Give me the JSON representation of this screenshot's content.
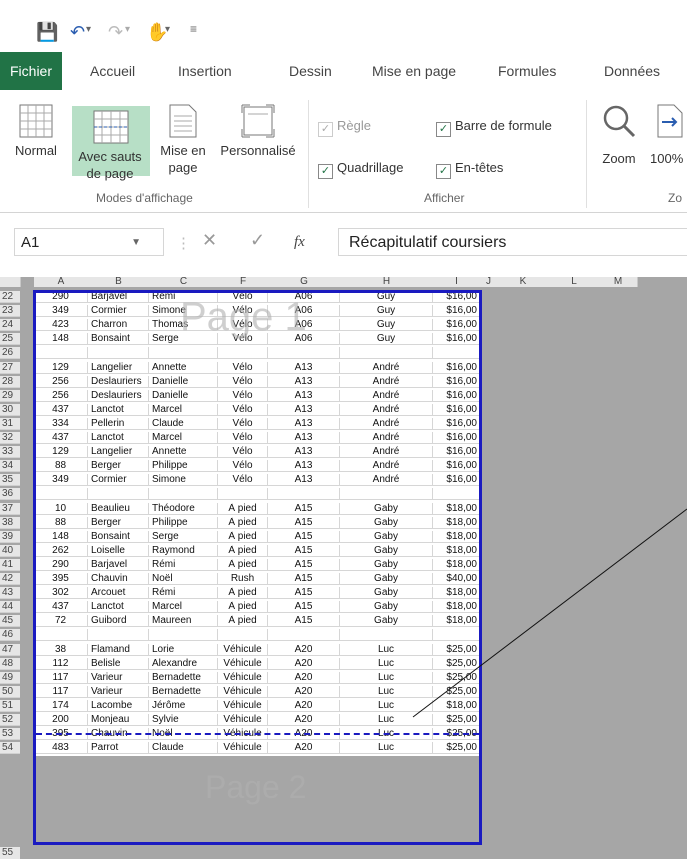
{
  "ribbon_tabs": [
    "Fichier",
    "Accueil",
    "Insertion",
    "Dessin",
    "Mise en page",
    "Formules",
    "Données"
  ],
  "view_group": {
    "buttons": [
      {
        "label": "Normal",
        "icon": "normal-view-icon"
      },
      {
        "label": "Avec sauts de page",
        "icon": "page-break-view-icon"
      },
      {
        "label": "Mise en page",
        "icon": "page-layout-view-icon"
      },
      {
        "label": "Personnalisé",
        "icon": "custom-view-icon"
      }
    ],
    "group_label": "Modes d'affichage"
  },
  "show_group": {
    "checks": [
      {
        "label": "Règle",
        "checked": true,
        "enabled": false
      },
      {
        "label": "Barre de formule",
        "checked": true,
        "enabled": true
      },
      {
        "label": "Quadrillage",
        "checked": true,
        "enabled": true
      },
      {
        "label": "En-têtes",
        "checked": true,
        "enabled": true
      }
    ],
    "group_label": "Afficher"
  },
  "zoom_group": {
    "zoom_label": "Zoom",
    "hundred_label": "100%",
    "group_label_partial": "Zo"
  },
  "formula_bar": {
    "name_box": "A1",
    "fx_label": "fx",
    "content": "Récapitulatif coursiers"
  },
  "columns": [
    "A",
    "B",
    "C",
    "F",
    "G",
    "H",
    "I",
    "J",
    "K",
    "L",
    "M"
  ],
  "rows": [
    {
      "n": "22",
      "cells": [
        "290",
        "Barjavel",
        "Rémi",
        "Vélo",
        "A06",
        "Guy",
        "$16,00"
      ]
    },
    {
      "n": "23",
      "cells": [
        "349",
        "Cormier",
        "Simone",
        "Vélo",
        "A06",
        "Guy",
        "$16,00"
      ]
    },
    {
      "n": "24",
      "cells": [
        "423",
        "Charron",
        "Thomas",
        "Vélo",
        "A06",
        "Guy",
        "$16,00"
      ]
    },
    {
      "n": "25",
      "cells": [
        "148",
        "Bonsaint",
        "Serge",
        "Vélo",
        "A06",
        "Guy",
        "$16,00"
      ]
    },
    {
      "n": "26",
      "cells": [
        "",
        "",
        "",
        "",
        "",
        "",
        ""
      ]
    },
    {
      "n": "27",
      "cells": [
        "129",
        "Langelier",
        "Annette",
        "Vélo",
        "A13",
        "André",
        "$16,00"
      ]
    },
    {
      "n": "28",
      "cells": [
        "256",
        "Deslauriers",
        "Danielle",
        "Vélo",
        "A13",
        "André",
        "$16,00"
      ]
    },
    {
      "n": "29",
      "cells": [
        "256",
        "Deslauriers",
        "Danielle",
        "Vélo",
        "A13",
        "André",
        "$16,00"
      ]
    },
    {
      "n": "30",
      "cells": [
        "437",
        "Lanctot",
        "Marcel",
        "Vélo",
        "A13",
        "André",
        "$16,00"
      ]
    },
    {
      "n": "31",
      "cells": [
        "334",
        "Pellerin",
        "Claude",
        "Vélo",
        "A13",
        "André",
        "$16,00"
      ]
    },
    {
      "n": "32",
      "cells": [
        "437",
        "Lanctot",
        "Marcel",
        "Vélo",
        "A13",
        "André",
        "$16,00"
      ]
    },
    {
      "n": "33",
      "cells": [
        "129",
        "Langelier",
        "Annette",
        "Vélo",
        "A13",
        "André",
        "$16,00"
      ]
    },
    {
      "n": "34",
      "cells": [
        "88",
        "Berger",
        "Philippe",
        "Vélo",
        "A13",
        "André",
        "$16,00"
      ]
    },
    {
      "n": "35",
      "cells": [
        "349",
        "Cormier",
        "Simone",
        "Vélo",
        "A13",
        "André",
        "$16,00"
      ]
    },
    {
      "n": "36",
      "cells": [
        "",
        "",
        "",
        "",
        "",
        "",
        ""
      ]
    },
    {
      "n": "37",
      "cells": [
        "10",
        "Beaulieu",
        "Théodore",
        "À pied",
        "A15",
        "Gaby",
        "$18,00"
      ]
    },
    {
      "n": "38",
      "cells": [
        "88",
        "Berger",
        "Philippe",
        "À pied",
        "A15",
        "Gaby",
        "$18,00"
      ]
    },
    {
      "n": "39",
      "cells": [
        "148",
        "Bonsaint",
        "Serge",
        "À pied",
        "A15",
        "Gaby",
        "$18,00"
      ]
    },
    {
      "n": "40",
      "cells": [
        "262",
        "Loiselle",
        "Raymond",
        "À pied",
        "A15",
        "Gaby",
        "$18,00"
      ]
    },
    {
      "n": "41",
      "cells": [
        "290",
        "Barjavel",
        "Rémi",
        "À pied",
        "A15",
        "Gaby",
        "$18,00"
      ]
    },
    {
      "n": "42",
      "cells": [
        "395",
        "Chauvin",
        "Noël",
        "Rush",
        "A15",
        "Gaby",
        "$40,00"
      ]
    },
    {
      "n": "43",
      "cells": [
        "302",
        "Arcouet",
        "Rémi",
        "À pied",
        "A15",
        "Gaby",
        "$18,00"
      ]
    },
    {
      "n": "44",
      "cells": [
        "437",
        "Lanctot",
        "Marcel",
        "À pied",
        "A15",
        "Gaby",
        "$18,00"
      ]
    },
    {
      "n": "45",
      "cells": [
        "72",
        "Guibord",
        "Maureen",
        "À pied",
        "A15",
        "Gaby",
        "$18,00"
      ]
    },
    {
      "n": "46",
      "cells": [
        "",
        "",
        "",
        "",
        "",
        "",
        ""
      ]
    },
    {
      "n": "47",
      "cells": [
        "38",
        "Flamand",
        "Lorie",
        "Véhicule",
        "A20",
        "Luc",
        "$25,00"
      ]
    },
    {
      "n": "48",
      "cells": [
        "112",
        "Belisle",
        "Alexandre",
        "Véhicule",
        "A20",
        "Luc",
        "$25,00"
      ]
    },
    {
      "n": "49",
      "cells": [
        "117",
        "Varieur",
        "Bernadette",
        "Véhicule",
        "A20",
        "Luc",
        "$25,00"
      ]
    },
    {
      "n": "50",
      "cells": [
        "117",
        "Varieur",
        "Bernadette",
        "Véhicule",
        "A20",
        "Luc",
        "$25,00"
      ]
    },
    {
      "n": "51",
      "cells": [
        "174",
        "Lacombe",
        "Jérôme",
        "Véhicule",
        "A20",
        "Luc",
        "$18,00"
      ]
    },
    {
      "n": "52",
      "cells": [
        "200",
        "Monjeau",
        "Sylvie",
        "Véhicule",
        "A20",
        "Luc",
        "$25,00"
      ]
    },
    {
      "n": "53",
      "cells": [
        "395",
        "Chauvin",
        "Noël",
        "Véhicule",
        "A20",
        "Luc",
        "$25,00"
      ]
    },
    {
      "n": "54",
      "cells": [
        "483",
        "Parrot",
        "Claude",
        "Véhicule",
        "A20",
        "Luc",
        "$25,00"
      ]
    }
  ],
  "below_row": "55",
  "watermarks": [
    "Page 1",
    "Page 2"
  ]
}
